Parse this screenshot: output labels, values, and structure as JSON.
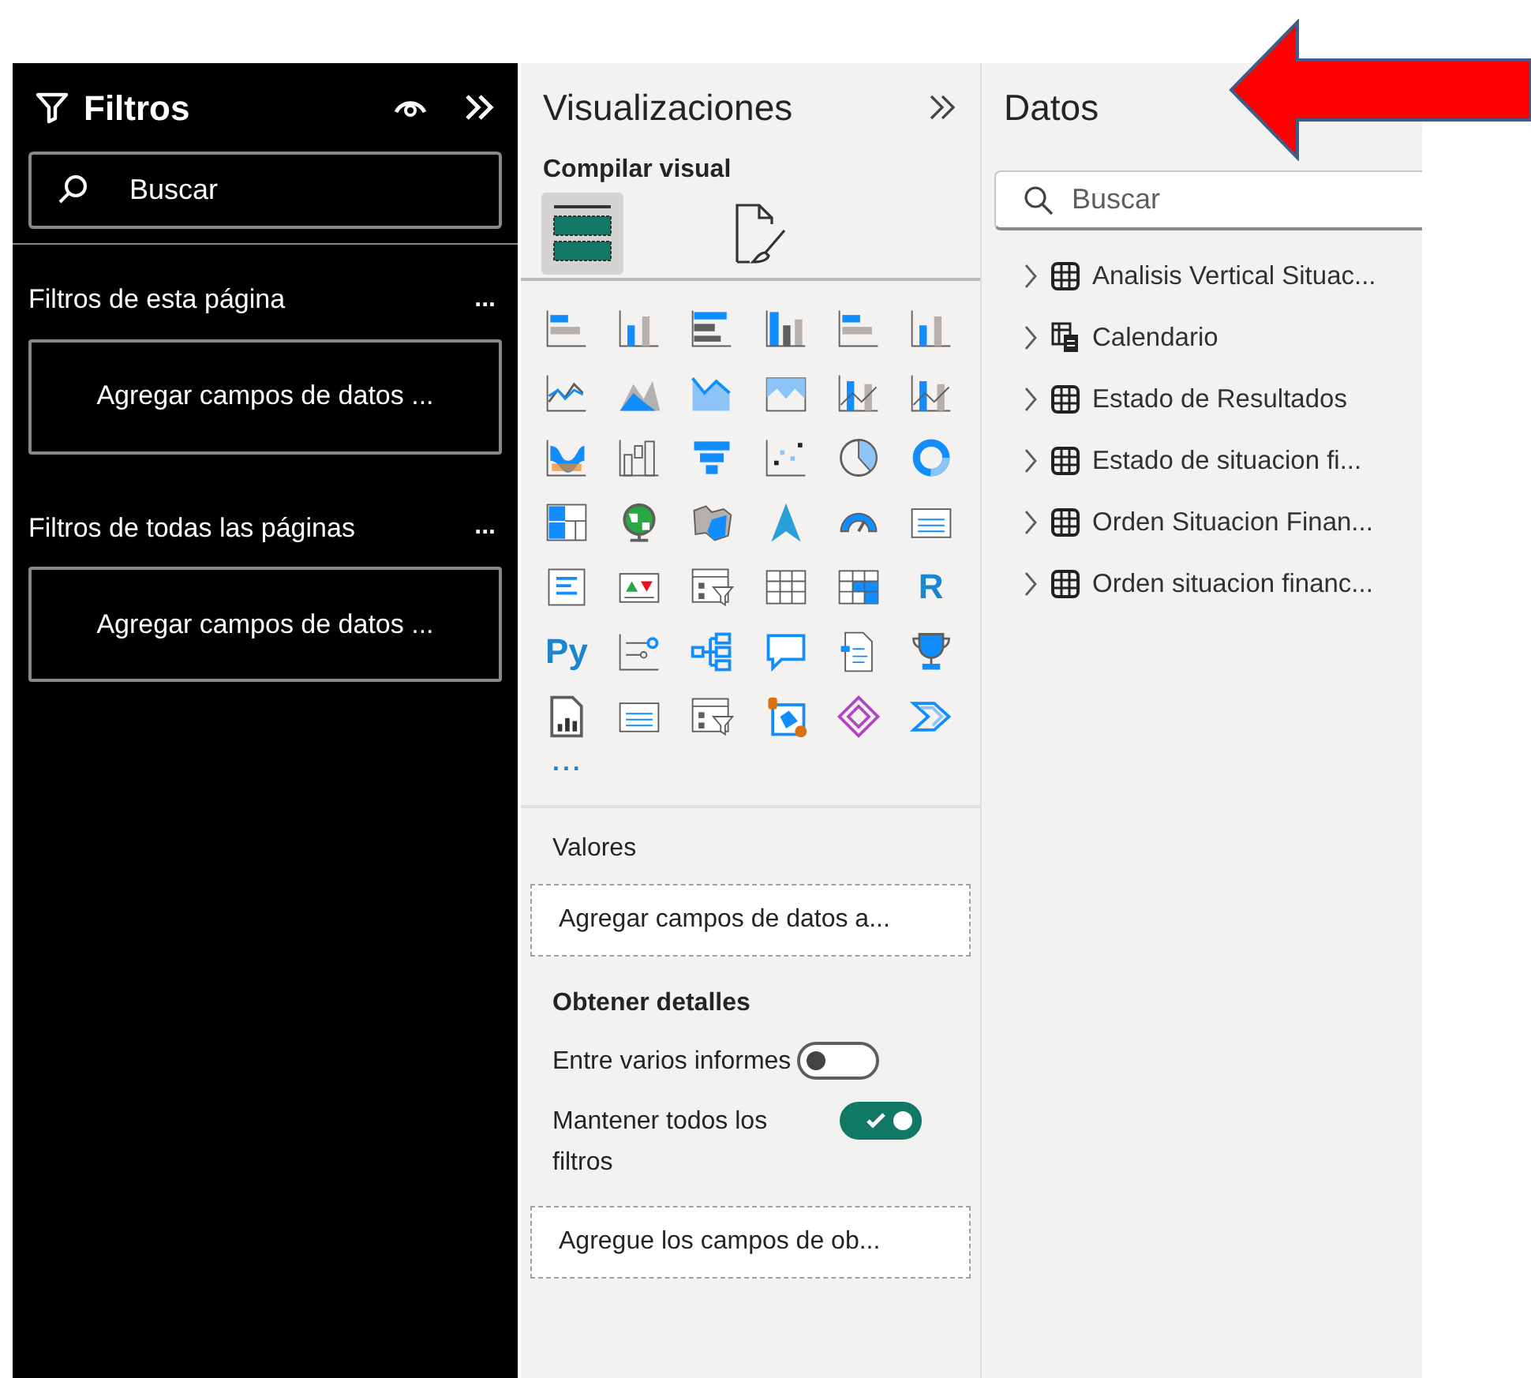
{
  "filters_pane": {
    "title": "Filtros",
    "search": {
      "placeholder": "Buscar"
    },
    "sections": [
      {
        "title": "Filtros de esta página",
        "more": "...",
        "drop_zone": "Agregar campos de datos ..."
      },
      {
        "title": "Filtros de todas las páginas",
        "more": "...",
        "drop_zone": "Agregar campos de datos ..."
      }
    ]
  },
  "visualizations_pane": {
    "title": "Visualizaciones",
    "subtitle": "Compilar visual",
    "modes": [
      {
        "kind": "build",
        "selected": true
      },
      {
        "kind": "format",
        "selected": false
      }
    ],
    "visual_types": [
      {
        "kind": "icon"
      },
      {
        "kind": "icon"
      },
      {
        "kind": "icon"
      },
      {
        "kind": "icon"
      },
      {
        "kind": "icon"
      },
      {
        "kind": "icon"
      },
      {
        "kind": "icon"
      },
      {
        "kind": "icon"
      },
      {
        "kind": "icon"
      },
      {
        "kind": "icon"
      },
      {
        "kind": "icon"
      },
      {
        "kind": "icon"
      },
      {
        "kind": "icon"
      },
      {
        "kind": "icon"
      },
      {
        "kind": "icon"
      },
      {
        "kind": "icon"
      },
      {
        "kind": "icon"
      },
      {
        "kind": "icon"
      },
      {
        "kind": "icon"
      },
      {
        "kind": "icon"
      },
      {
        "kind": "icon"
      },
      {
        "kind": "icon"
      },
      {
        "kind": "icon"
      },
      {
        "kind": "icon"
      },
      {
        "kind": "icon"
      },
      {
        "kind": "icon"
      },
      {
        "kind": "icon"
      },
      {
        "kind": "icon"
      },
      {
        "kind": "icon"
      },
      {
        "kind": "text",
        "label": "R"
      },
      {
        "kind": "text",
        "label": "Py"
      },
      {
        "kind": "icon"
      },
      {
        "kind": "icon"
      },
      {
        "kind": "icon"
      },
      {
        "kind": "icon"
      },
      {
        "kind": "icon"
      },
      {
        "kind": "icon"
      },
      {
        "kind": "icon"
      },
      {
        "kind": "icon"
      },
      {
        "kind": "icon"
      },
      {
        "kind": "icon"
      },
      {
        "kind": "icon"
      }
    ],
    "more": "...",
    "values": {
      "label": "Valores",
      "drop_zone": "Agregar campos de datos a..."
    },
    "drillthrough": {
      "label": "Obtener detalles",
      "toggles": [
        {
          "label": "Entre varios informes",
          "on": false
        },
        {
          "label": "Mantener todos los filtros",
          "on": true
        }
      ],
      "drop_zone": "Agregue los campos de ob..."
    }
  },
  "data_pane": {
    "title": "Datos",
    "search": {
      "placeholder": "Buscar"
    },
    "tables": [
      {
        "name": "Analisis Vertical Situac...",
        "kind": "table",
        "expanded": false
      },
      {
        "name": "Calendario",
        "kind": "calculated",
        "expanded": false
      },
      {
        "name": "Estado de Resultados",
        "kind": "table",
        "expanded": false
      },
      {
        "name": "Estado de situacion fi...",
        "kind": "table",
        "expanded": false
      },
      {
        "name": "Orden Situacion Finan...",
        "kind": "table",
        "expanded": false
      },
      {
        "name": "Orden situacion financ...",
        "kind": "table",
        "expanded": false
      }
    ]
  }
}
